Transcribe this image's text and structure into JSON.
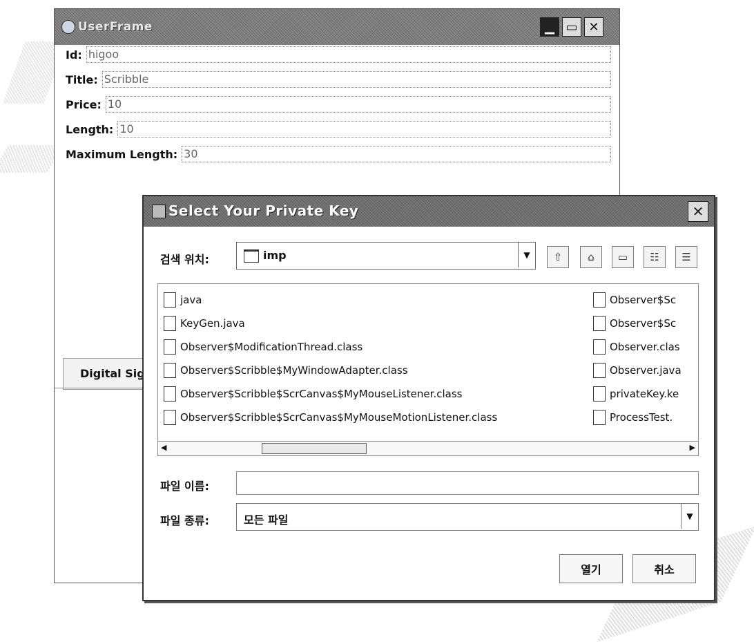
{
  "back_window": {
    "title": "UserFrame",
    "fields": [
      {
        "label": "Id:",
        "value": "higoo"
      },
      {
        "label": "Title:",
        "value": "Scribble"
      },
      {
        "label": "Price:",
        "value": "10"
      },
      {
        "label": "Length:",
        "value": "10"
      },
      {
        "label": "Maximum Length:",
        "value": "30"
      }
    ],
    "tab_label": "Digital Sig"
  },
  "dialog": {
    "title": "Select Your Private Key",
    "look_in_label": "검색 위치:",
    "look_in_value": "imp",
    "files_col1": [
      "java",
      "KeyGen.java",
      "Observer$ModificationThread.class",
      "Observer$Scribble$MyWindowAdapter.class",
      "Observer$Scribble$ScrCanvas$MyMouseListener.class",
      "Observer$Scribble$ScrCanvas$MyMouseMotionListener.class"
    ],
    "files_col2": [
      "Observer$Sc",
      "Observer$Sc",
      "Observer.clas",
      "Observer.java",
      "privateKey.ke",
      "ProcessTest."
    ],
    "file_name_label": "파일 이름:",
    "file_name_value": "",
    "file_type_label": "파일 종류:",
    "file_type_value": "모든 파일",
    "open_label": "열기",
    "cancel_label": "취소"
  }
}
